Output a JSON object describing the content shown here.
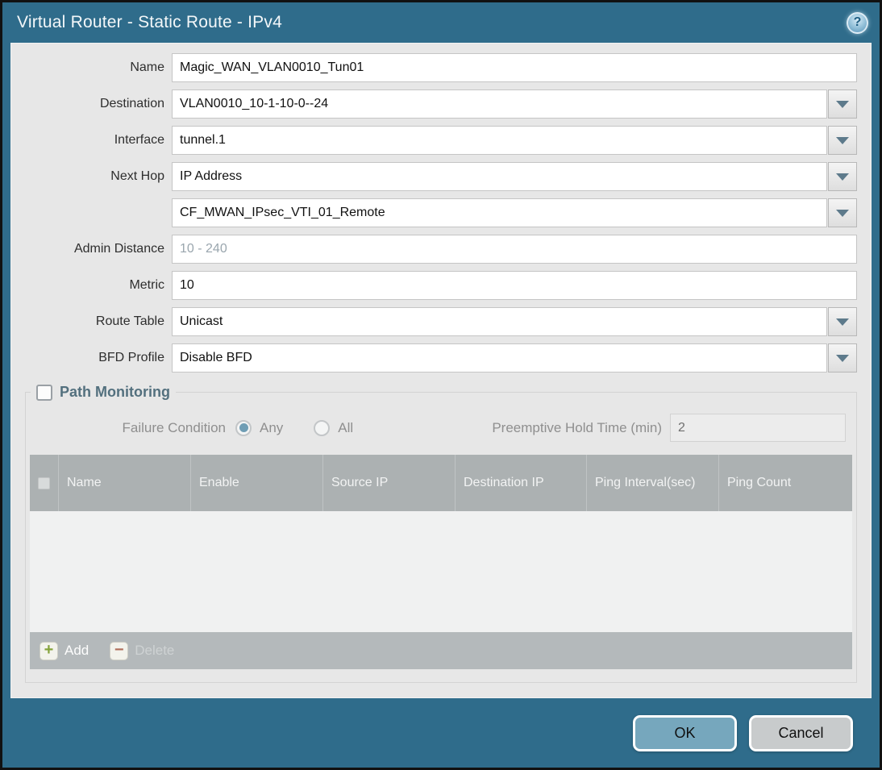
{
  "window": {
    "title": "Virtual Router - Static Route - IPv4",
    "help_icon": "?"
  },
  "colors": {
    "frame_teal": "#2f6c8b",
    "content_bg": "#e7e7e7",
    "table_header_bg": "#acb1b2",
    "ok_button_bg": "#76a7bd",
    "cancel_button_bg": "#c8cbcc",
    "add_icon_green": "#85a33b",
    "delete_icon_red": "#b06f5b",
    "radio_selected": "#6f9db4",
    "pm_title_color": "#53707e"
  },
  "form": {
    "fields": [
      {
        "label": "Name",
        "type": "text",
        "value": "Magic_WAN_VLAN0010_Tun01"
      },
      {
        "label": "Destination",
        "type": "dropdown",
        "value": "VLAN0010_10-1-10-0--24"
      },
      {
        "label": "Interface",
        "type": "dropdown",
        "value": "tunnel.1"
      },
      {
        "label": "Next Hop",
        "type": "dropdown",
        "value": "IP Address"
      },
      {
        "label": "",
        "type": "dropdown",
        "value": "CF_MWAN_IPsec_VTI_01_Remote"
      },
      {
        "label": "Admin Distance",
        "type": "text",
        "value": "",
        "placeholder": "10 - 240"
      },
      {
        "label": "Metric",
        "type": "text",
        "value": "10"
      },
      {
        "label": "Route Table",
        "type": "dropdown",
        "value": "Unicast"
      },
      {
        "label": "BFD Profile",
        "type": "dropdown",
        "value": "Disable BFD"
      }
    ]
  },
  "path_monitoring": {
    "title": "Path Monitoring",
    "checked": false,
    "failure_condition_label": "Failure Condition",
    "radio_any_label": "Any",
    "radio_all_label": "All",
    "radio_selected": "Any",
    "preemptive_label": "Preemptive Hold Time (min)",
    "preemptive_value": "2",
    "table": {
      "headers": [
        "Name",
        "Enable",
        "Source IP",
        "Destination IP",
        "Ping Interval(sec)",
        "Ping Count"
      ],
      "rows": []
    },
    "add_label": "Add",
    "delete_label": "Delete"
  },
  "footer": {
    "ok_label": "OK",
    "cancel_label": "Cancel"
  }
}
